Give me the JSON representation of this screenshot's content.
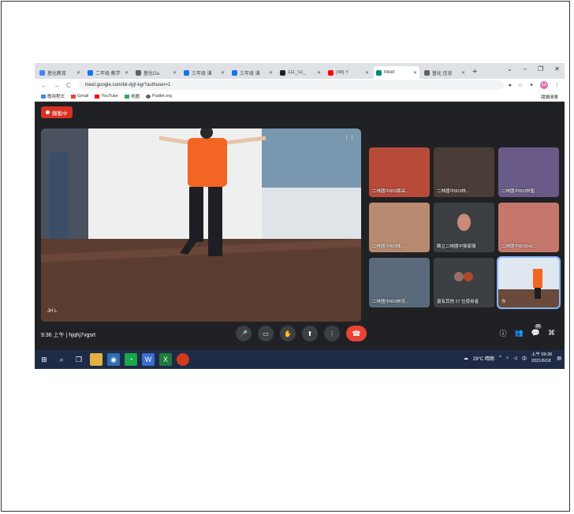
{
  "browser": {
    "tabs": [
      {
        "label": "基化教育",
        "icon_color": "#4285f4"
      },
      {
        "label": "二年级 教学",
        "icon_color": "#1a73e8"
      },
      {
        "label": "基化Ga",
        "icon_color": "#5f6368"
      },
      {
        "label": "三年级 课",
        "icon_color": "#1a73e8"
      },
      {
        "label": "三年级 课",
        "icon_color": "#1a73e8"
      },
      {
        "label": "111_02_",
        "icon_color": "#202124"
      },
      {
        "label": "(48) Y",
        "icon_color": "#ff0000"
      },
      {
        "label": "Meet",
        "icon_color": "#00897b",
        "active": true
      },
      {
        "label": "基化 信息",
        "icon_color": "#5f6368"
      }
    ],
    "new_tab": "+",
    "window_controls": [
      "⌄",
      "–",
      "❐",
      "✕"
    ],
    "nav": {
      "back": "←",
      "forward": "→",
      "reload": "C"
    },
    "url": "meet.google.com/bii-dyjl-kgr?authuser=1",
    "profile_initials": "EA",
    "bookmarks": [
      {
        "label": "應用程式",
        "color": "#4285f4"
      },
      {
        "label": "Gmail",
        "color": "#ea4335"
      },
      {
        "label": "YouTube",
        "color": "#ff0000"
      },
      {
        "label": "地圖",
        "color": "#34a853"
      },
      {
        "label": "Padlet.org",
        "color": "#5f6368"
      }
    ],
    "reading_list": "閱讀清單"
  },
  "meet": {
    "recording_label": "錄製中",
    "main_speaker_name": "JH L",
    "tiles": [
      {
        "name": "二林國中803賴采...",
        "bg": "#b84a3a"
      },
      {
        "name": "二林國中803林...",
        "bg": "#4a3c36"
      },
      {
        "name": "二林國中803林聖...",
        "bg": "#6a5a88"
      },
      {
        "name": "二林國中803陳...",
        "bg": "#b88a70"
      },
      {
        "name": "縣立二林國中張家碩",
        "bg": "#3c4043"
      },
      {
        "name": "二林國中803041...",
        "bg": "#c4776a"
      },
      {
        "name": "二林國中803林芳...",
        "bg": "#5a6a7a"
      },
      {
        "name": "還有其他 27 位使用者",
        "bg": "#3c4043"
      },
      {
        "name": "你",
        "bg": "#dfe8f0"
      }
    ],
    "meeting_info": "9:36 上午  |  hjqhj7vgsrt",
    "participant_count": "36",
    "controls": {
      "mic": "🎤",
      "camera": "▭",
      "hand": "✋",
      "present": "⬆",
      "more": "⋮",
      "end": "☎"
    },
    "right_controls": {
      "info": "ⓘ",
      "people": "👥",
      "chat": "💬",
      "activities": "⌘"
    }
  },
  "taskbar": {
    "weather": "29°C 晴朗",
    "ime": "中",
    "time": "上午 09:36",
    "date": "2021/6/18"
  }
}
